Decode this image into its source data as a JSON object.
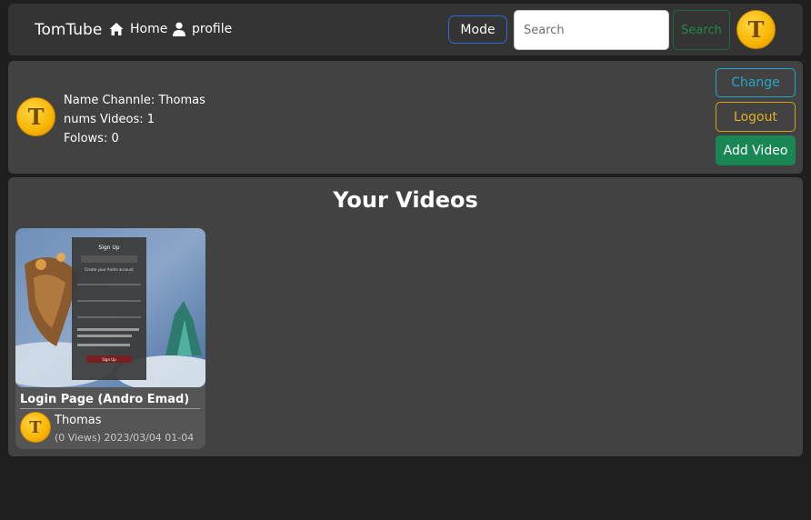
{
  "navbar": {
    "brand": "TomTube",
    "home_label": "Home",
    "profile_label": "profile",
    "mode_label": "Mode",
    "search_placeholder": "Search",
    "search_button": "Search",
    "avatar_letter": "T"
  },
  "channel": {
    "name_line": "Name Channle: Thomas",
    "videos_line": "nums Videos: 1",
    "follows_line": "Folows: 0",
    "avatar_letter": "T",
    "change_label": "Change",
    "logout_label": "Logout",
    "add_video_label": "Add Video"
  },
  "videos": {
    "heading": "Your Videos",
    "items": [
      {
        "title": "Login Page (Andro Emad)",
        "channel": "Thomas",
        "meta": "(0 Views) 2023/03/04 01-04",
        "avatar_letter": "T",
        "thumbnail_form_title": "Sign Up",
        "thumbnail_form_subtitle": "Create your Andro account",
        "thumbnail_form_button": "Sign Up"
      }
    ]
  },
  "colors": {
    "background": "#1f1f1f",
    "navbar": "#343434",
    "card": "#424242",
    "change": "#22a9c9",
    "logout": "#d4a017",
    "add": "#198754",
    "mode_border": "#2f6bd6"
  },
  "icons": [
    "home-icon",
    "user-icon"
  ]
}
